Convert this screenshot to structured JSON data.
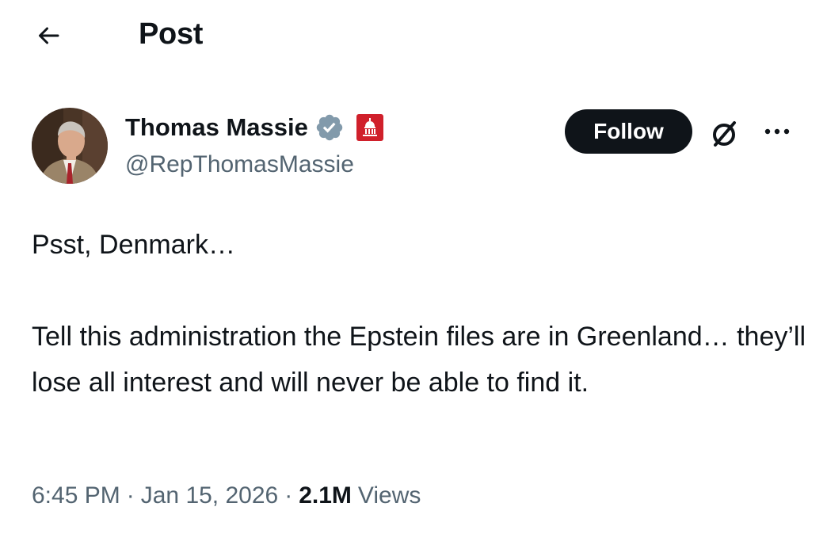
{
  "header": {
    "title": "Post",
    "back_icon": "arrow-left-icon"
  },
  "author": {
    "display_name": "Thomas Massie",
    "handle": "@RepThomasMassie",
    "verified_icon": "verified-badge-icon",
    "verified_color": "#829aab",
    "affiliation_icon": "capitol-dome-icon",
    "affiliation_color": "#d0202b"
  },
  "actions": {
    "follow_label": "Follow",
    "grok_icon": "grok-icon",
    "more_icon": "more-dots-icon"
  },
  "post": {
    "paragraphs": [
      "Psst, Denmark…",
      "Tell this administration the Epstein files are in Greenland… they’ll lose all interest and will never be able to find it."
    ]
  },
  "meta": {
    "time": "6:45 PM",
    "separator": "·",
    "date": "Jan 15, 2026",
    "views_count": "2.1M",
    "views_label": "Views"
  },
  "colors": {
    "text_primary": "#0f1419",
    "text_secondary": "#536471",
    "follow_bg": "#0f1419",
    "follow_text": "#ffffff"
  }
}
